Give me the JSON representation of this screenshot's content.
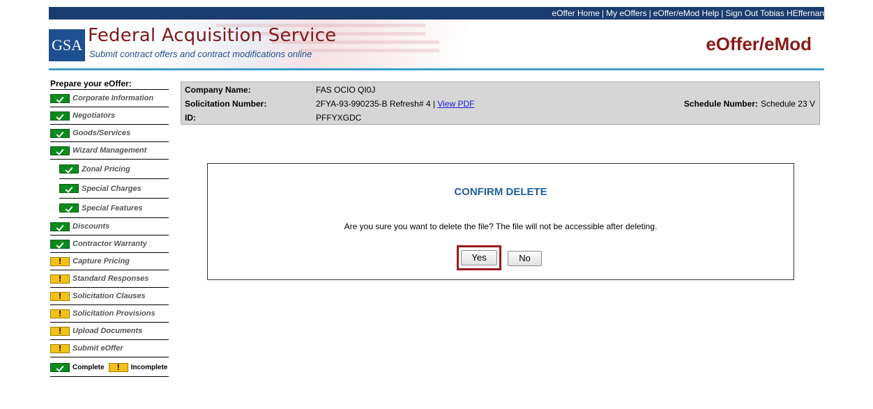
{
  "topnav": {
    "home": "eOffer Home",
    "my_eoffers": "My eOffers",
    "help": "eOffer/eMod Help",
    "signout": "Sign Out Tobias HEffernan",
    "separator": "|"
  },
  "header": {
    "logo": "GSA",
    "title": "Federal Acquisition Service",
    "subtitle": "Submit contract offers and contract modifications online",
    "app_title": "eOffer/eMod"
  },
  "sidebar": {
    "heading": "Prepare your eOffer:",
    "items": [
      {
        "label": "Corporate Information",
        "status": "complete",
        "sub": false
      },
      {
        "label": "Negotiators",
        "status": "complete",
        "sub": false
      },
      {
        "label": "Goods/Services",
        "status": "complete",
        "sub": false
      },
      {
        "label": "Wizard Management",
        "status": "complete",
        "sub": false
      },
      {
        "label": "Zonal Pricing",
        "status": "complete",
        "sub": true
      },
      {
        "label": "Special Charges",
        "status": "complete",
        "sub": true
      },
      {
        "label": "Special Features",
        "status": "complete",
        "sub": true
      },
      {
        "label": "Discounts",
        "status": "complete",
        "sub": false
      },
      {
        "label": "Contractor Warranty",
        "status": "complete",
        "sub": false
      },
      {
        "label": "Capture Pricing",
        "status": "incomplete",
        "sub": false
      },
      {
        "label": "Standard Responses",
        "status": "incomplete",
        "sub": false
      },
      {
        "label": "Solicitation Clauses",
        "status": "incomplete",
        "sub": false
      },
      {
        "label": "Solicitation Provisions",
        "status": "incomplete",
        "sub": false
      },
      {
        "label": "Upload Documents",
        "status": "incomplete",
        "sub": false
      },
      {
        "label": "Submit eOffer",
        "status": "incomplete",
        "sub": false
      }
    ],
    "legend": {
      "complete": "Complete",
      "incomplete": "Incomplete"
    }
  },
  "info": {
    "company_label": "Company Name:",
    "company_value": "FAS OCIO QI0J",
    "solicitation_label": "Solicitation Number:",
    "solicitation_value": "2FYA-93-990235-B Refresh# 4 |",
    "view_pdf": "View PDF",
    "id_label": "ID:",
    "id_value": "PFFYXGDC",
    "schedule_label": "Schedule Number:",
    "schedule_value": "Schedule 23 V"
  },
  "dialog": {
    "title": "CONFIRM DELETE",
    "message": "Are you sure you want to delete the file? The file will not be accessible after deleting.",
    "yes": "Yes",
    "no": "No"
  },
  "colors": {
    "topbar": "#1a3c6e",
    "brand_red": "#8b1a1a",
    "rule_blue": "#3c9fcc",
    "complete_green": "#0c8a1e",
    "incomplete_yellow": "#f3c11a",
    "dialog_title": "#1f5f9e"
  }
}
